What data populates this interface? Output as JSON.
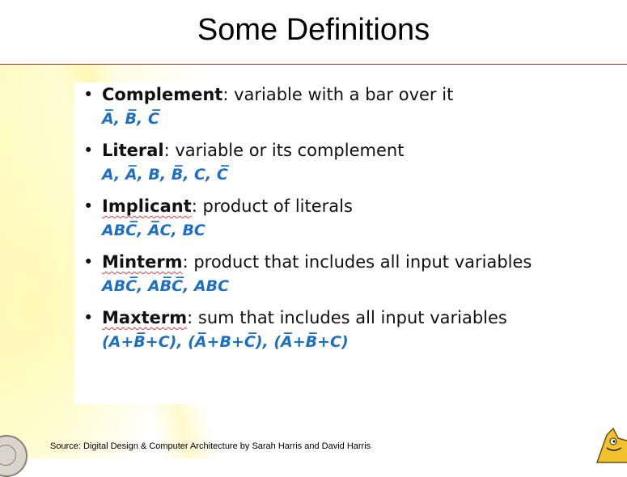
{
  "slide": {
    "title": "Some Definitions"
  },
  "definitions": [
    {
      "term": "Complement",
      "description": ": variable with a bar over it",
      "example": "A̅, B̅, C̅"
    },
    {
      "term": "Literal",
      "description": ": variable or its complement",
      "example": "A, A̅, B, B̅, C, C̅"
    },
    {
      "term": "Implicant",
      "description": ": product of literals",
      "example": "ABC̅, A̅C, BC"
    },
    {
      "term": "Minterm",
      "description": ": product that includes all input variables",
      "example": "ABC̅, AB̅C̅, ABC"
    },
    {
      "term": "Maxterm",
      "description": ": sum that includes all input variables",
      "example": "(A+B̅+C), (A̅+B+C̅), (A̅+B̅+C)"
    }
  ],
  "footer": {
    "source": "Source: Digital Design & Computer Architecture by Sarah Harris and David Harris"
  },
  "colors": {
    "example_text": "#1f6fc0",
    "title_rule": "#b03a2e",
    "background_glow": "#fff39a"
  },
  "icons": {
    "bottom_left": "university-seal-icon",
    "bottom_right": "mascot-icon"
  }
}
